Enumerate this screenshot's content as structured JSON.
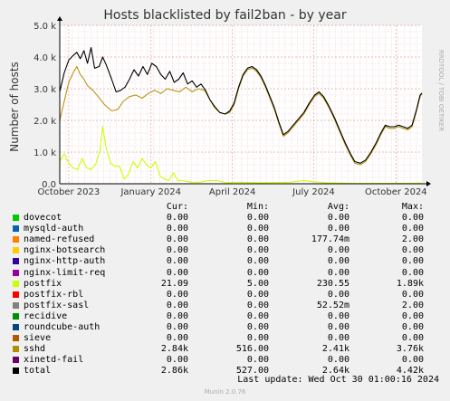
{
  "chart_data": {
    "type": "line",
    "title": "Hosts blacklisted by fail2ban - by year",
    "ylabel": "Number of hosts",
    "watermark": "RRDTOOL / TOBI OETIKER",
    "xticks": [
      "October 2023",
      "January 2024",
      "April 2024",
      "July 2024",
      "October 2024"
    ],
    "yticks": [
      "0.0",
      "1.0 k",
      "2.0 k",
      "3.0 k",
      "4.0 k",
      "5.0 k"
    ],
    "ylim": [
      0,
      5000
    ],
    "xlim": [
      "2023-09-21",
      "2024-10-30"
    ],
    "grid": true,
    "series": [
      {
        "name": "sshd",
        "color": "#b89614",
        "points": [
          [
            "2023-09-21",
            2000
          ],
          [
            "2023-09-26",
            2600
          ],
          [
            "2023-10-01",
            3200
          ],
          [
            "2023-10-06",
            3500
          ],
          [
            "2023-10-10",
            3700
          ],
          [
            "2023-10-14",
            3450
          ],
          [
            "2023-10-18",
            3300
          ],
          [
            "2023-10-22",
            3100
          ],
          [
            "2023-10-28",
            2950
          ],
          [
            "2023-11-03",
            2750
          ],
          [
            "2023-11-10",
            2500
          ],
          [
            "2023-11-18",
            2300
          ],
          [
            "2023-11-25",
            2350
          ],
          [
            "2023-12-01",
            2600
          ],
          [
            "2023-12-08",
            2750
          ],
          [
            "2023-12-15",
            2800
          ],
          [
            "2023-12-22",
            2700
          ],
          [
            "2023-12-29",
            2850
          ],
          [
            "2024-01-05",
            2950
          ],
          [
            "2024-01-12",
            2850
          ],
          [
            "2024-01-19",
            3000
          ],
          [
            "2024-01-26",
            2950
          ],
          [
            "2024-02-02",
            2900
          ],
          [
            "2024-02-09",
            3050
          ],
          [
            "2024-02-16",
            2900
          ],
          [
            "2024-02-23",
            3000
          ],
          [
            "2024-03-01",
            2950
          ],
          [
            "2024-03-06",
            2700
          ],
          [
            "2024-03-12",
            2400
          ],
          [
            "2024-03-18",
            2250
          ],
          [
            "2024-03-24",
            2200
          ],
          [
            "2024-03-29",
            2250
          ],
          [
            "2024-04-03",
            2500
          ],
          [
            "2024-04-08",
            3000
          ],
          [
            "2024-04-13",
            3400
          ],
          [
            "2024-04-18",
            3600
          ],
          [
            "2024-04-23",
            3650
          ],
          [
            "2024-04-28",
            3550
          ],
          [
            "2024-05-03",
            3350
          ],
          [
            "2024-05-08",
            3050
          ],
          [
            "2024-05-13",
            2700
          ],
          [
            "2024-05-18",
            2350
          ],
          [
            "2024-05-23",
            1900
          ],
          [
            "2024-05-28",
            1500
          ],
          [
            "2024-06-02",
            1600
          ],
          [
            "2024-06-08",
            1800
          ],
          [
            "2024-06-14",
            2000
          ],
          [
            "2024-06-20",
            2200
          ],
          [
            "2024-06-26",
            2500
          ],
          [
            "2024-07-02",
            2750
          ],
          [
            "2024-07-07",
            2850
          ],
          [
            "2024-07-12",
            2700
          ],
          [
            "2024-07-18",
            2400
          ],
          [
            "2024-07-24",
            2050
          ],
          [
            "2024-07-30",
            1650
          ],
          [
            "2024-08-05",
            1250
          ],
          [
            "2024-08-11",
            900
          ],
          [
            "2024-08-16",
            650
          ],
          [
            "2024-08-22",
            600
          ],
          [
            "2024-08-28",
            700
          ],
          [
            "2024-09-03",
            950
          ],
          [
            "2024-09-09",
            1250
          ],
          [
            "2024-09-14",
            1550
          ],
          [
            "2024-09-19",
            1800
          ],
          [
            "2024-09-24",
            1750
          ],
          [
            "2024-09-29",
            1750
          ],
          [
            "2024-10-04",
            1800
          ],
          [
            "2024-10-09",
            1750
          ],
          [
            "2024-10-14",
            1700
          ],
          [
            "2024-10-19",
            1800
          ],
          [
            "2024-10-24",
            2300
          ],
          [
            "2024-10-28",
            2750
          ],
          [
            "2024-10-30",
            2840
          ]
        ]
      },
      {
        "name": "postfix",
        "color": "#ccff00",
        "points": [
          [
            "2023-09-21",
            700
          ],
          [
            "2023-09-26",
            950
          ],
          [
            "2023-10-01",
            650
          ],
          [
            "2023-10-06",
            500
          ],
          [
            "2023-10-11",
            450
          ],
          [
            "2023-10-16",
            800
          ],
          [
            "2023-10-21",
            500
          ],
          [
            "2023-10-26",
            450
          ],
          [
            "2023-10-31",
            600
          ],
          [
            "2023-11-05",
            1050
          ],
          [
            "2023-11-08",
            1800
          ],
          [
            "2023-11-12",
            1100
          ],
          [
            "2023-11-17",
            650
          ],
          [
            "2023-11-22",
            550
          ],
          [
            "2023-11-27",
            550
          ],
          [
            "2023-12-02",
            150
          ],
          [
            "2023-12-07",
            300
          ],
          [
            "2023-12-12",
            700
          ],
          [
            "2023-12-17",
            500
          ],
          [
            "2023-12-22",
            800
          ],
          [
            "2023-12-27",
            600
          ],
          [
            "2024-01-01",
            500
          ],
          [
            "2024-01-06",
            700
          ],
          [
            "2024-01-11",
            250
          ],
          [
            "2024-01-16",
            150
          ],
          [
            "2024-01-21",
            100
          ],
          [
            "2024-01-26",
            350
          ],
          [
            "2024-01-31",
            100
          ],
          [
            "2024-02-05",
            100
          ],
          [
            "2024-02-15",
            50
          ],
          [
            "2024-02-25",
            50
          ],
          [
            "2024-03-05",
            100
          ],
          [
            "2024-03-15",
            100
          ],
          [
            "2024-03-25",
            30
          ],
          [
            "2024-04-10",
            50
          ],
          [
            "2024-05-01",
            30
          ],
          [
            "2024-05-20",
            40
          ],
          [
            "2024-06-05",
            50
          ],
          [
            "2024-06-20",
            100
          ],
          [
            "2024-07-01",
            60
          ],
          [
            "2024-07-15",
            30
          ],
          [
            "2024-08-01",
            20
          ],
          [
            "2024-08-20",
            10
          ],
          [
            "2024-09-15",
            15
          ],
          [
            "2024-10-10",
            15
          ],
          [
            "2024-10-30",
            21
          ]
        ]
      },
      {
        "name": "total",
        "color": "#000000",
        "points": [
          [
            "2023-09-21",
            2900
          ],
          [
            "2023-09-26",
            3500
          ],
          [
            "2023-10-01",
            3900
          ],
          [
            "2023-10-06",
            4050
          ],
          [
            "2023-10-10",
            4150
          ],
          [
            "2023-10-14",
            3950
          ],
          [
            "2023-10-18",
            4200
          ],
          [
            "2023-10-22",
            3800
          ],
          [
            "2023-10-26",
            4300
          ],
          [
            "2023-10-30",
            3650
          ],
          [
            "2023-11-04",
            3700
          ],
          [
            "2023-11-08",
            4000
          ],
          [
            "2023-11-12",
            3750
          ],
          [
            "2023-11-18",
            3300
          ],
          [
            "2023-11-23",
            2900
          ],
          [
            "2023-11-28",
            2950
          ],
          [
            "2023-12-03",
            3050
          ],
          [
            "2023-12-08",
            3300
          ],
          [
            "2023-12-13",
            3600
          ],
          [
            "2023-12-18",
            3400
          ],
          [
            "2023-12-23",
            3700
          ],
          [
            "2023-12-28",
            3450
          ],
          [
            "2024-01-02",
            3800
          ],
          [
            "2024-01-07",
            3700
          ],
          [
            "2024-01-12",
            3450
          ],
          [
            "2024-01-17",
            3300
          ],
          [
            "2024-01-22",
            3550
          ],
          [
            "2024-01-27",
            3200
          ],
          [
            "2024-02-01",
            3300
          ],
          [
            "2024-02-06",
            3500
          ],
          [
            "2024-02-11",
            3150
          ],
          [
            "2024-02-16",
            3250
          ],
          [
            "2024-02-21",
            3050
          ],
          [
            "2024-02-26",
            3150
          ],
          [
            "2024-03-02",
            2950
          ],
          [
            "2024-03-07",
            2650
          ],
          [
            "2024-03-12",
            2450
          ],
          [
            "2024-03-18",
            2250
          ],
          [
            "2024-03-24",
            2200
          ],
          [
            "2024-03-29",
            2300
          ],
          [
            "2024-04-03",
            2550
          ],
          [
            "2024-04-08",
            3050
          ],
          [
            "2024-04-13",
            3450
          ],
          [
            "2024-04-18",
            3650
          ],
          [
            "2024-04-23",
            3700
          ],
          [
            "2024-04-28",
            3600
          ],
          [
            "2024-05-03",
            3400
          ],
          [
            "2024-05-08",
            3100
          ],
          [
            "2024-05-13",
            2750
          ],
          [
            "2024-05-18",
            2400
          ],
          [
            "2024-05-23",
            1950
          ],
          [
            "2024-05-28",
            1550
          ],
          [
            "2024-06-02",
            1650
          ],
          [
            "2024-06-08",
            1850
          ],
          [
            "2024-06-14",
            2050
          ],
          [
            "2024-06-20",
            2250
          ],
          [
            "2024-06-26",
            2550
          ],
          [
            "2024-07-02",
            2800
          ],
          [
            "2024-07-07",
            2900
          ],
          [
            "2024-07-12",
            2750
          ],
          [
            "2024-07-18",
            2450
          ],
          [
            "2024-07-24",
            2100
          ],
          [
            "2024-07-30",
            1700
          ],
          [
            "2024-08-05",
            1300
          ],
          [
            "2024-08-11",
            950
          ],
          [
            "2024-08-16",
            700
          ],
          [
            "2024-08-22",
            650
          ],
          [
            "2024-08-28",
            750
          ],
          [
            "2024-09-03",
            1000
          ],
          [
            "2024-09-09",
            1300
          ],
          [
            "2024-09-14",
            1600
          ],
          [
            "2024-09-19",
            1850
          ],
          [
            "2024-09-24",
            1800
          ],
          [
            "2024-09-29",
            1800
          ],
          [
            "2024-10-04",
            1850
          ],
          [
            "2024-10-09",
            1800
          ],
          [
            "2024-10-14",
            1750
          ],
          [
            "2024-10-19",
            1850
          ],
          [
            "2024-10-24",
            2350
          ],
          [
            "2024-10-28",
            2800
          ],
          [
            "2024-10-30",
            2860
          ]
        ]
      }
    ]
  },
  "legend": {
    "headers": {
      "cur": "Cur:",
      "min": "Min:",
      "avg": "Avg:",
      "max": "Max:"
    },
    "rows": [
      {
        "name": "dovecot",
        "color": "#00cc00",
        "cur": "0.00",
        "min": "0.00",
        "avg": "0.00",
        "max": "0.00"
      },
      {
        "name": "mysqld-auth",
        "color": "#0066b3",
        "cur": "0.00",
        "min": "0.00",
        "avg": "0.00",
        "max": "0.00"
      },
      {
        "name": "named-refused",
        "color": "#ff8000",
        "cur": "0.00",
        "min": "0.00",
        "avg": "177.74m",
        "max": "2.00"
      },
      {
        "name": "nginx-botsearch",
        "color": "#ffcc00",
        "cur": "0.00",
        "min": "0.00",
        "avg": "0.00",
        "max": "0.00"
      },
      {
        "name": "nginx-http-auth",
        "color": "#330099",
        "cur": "0.00",
        "min": "0.00",
        "avg": "0.00",
        "max": "0.00"
      },
      {
        "name": "nginx-limit-req",
        "color": "#990099",
        "cur": "0.00",
        "min": "0.00",
        "avg": "0.00",
        "max": "0.00"
      },
      {
        "name": "postfix",
        "color": "#ccff00",
        "cur": "21.09",
        "min": "5.00",
        "avg": "230.55",
        "max": "1.89k"
      },
      {
        "name": "postfix-rbl",
        "color": "#ff0000",
        "cur": "0.00",
        "min": "0.00",
        "avg": "0.00",
        "max": "0.00"
      },
      {
        "name": "postfix-sasl",
        "color": "#808080",
        "cur": "0.00",
        "min": "0.00",
        "avg": "52.52m",
        "max": "2.00"
      },
      {
        "name": "recidive",
        "color": "#008f00",
        "cur": "0.00",
        "min": "0.00",
        "avg": "0.00",
        "max": "0.00"
      },
      {
        "name": "roundcube-auth",
        "color": "#00487d",
        "cur": "0.00",
        "min": "0.00",
        "avg": "0.00",
        "max": "0.00"
      },
      {
        "name": "sieve",
        "color": "#b35a00",
        "cur": "0.00",
        "min": "0.00",
        "avg": "0.00",
        "max": "0.00"
      },
      {
        "name": "sshd",
        "color": "#b38f00",
        "cur": "2.84k",
        "min": "516.00",
        "avg": "2.41k",
        "max": "3.76k"
      },
      {
        "name": "xinetd-fail",
        "color": "#6b006b",
        "cur": "0.00",
        "min": "0.00",
        "avg": "0.00",
        "max": "0.00"
      },
      {
        "name": "total",
        "color": "#000000",
        "cur": "2.86k",
        "min": "527.00",
        "avg": "2.64k",
        "max": "4.42k"
      }
    ]
  },
  "last_update": "Last update: Wed Oct 30 01:00:16 2024",
  "footer": "Munin 2.0.76"
}
